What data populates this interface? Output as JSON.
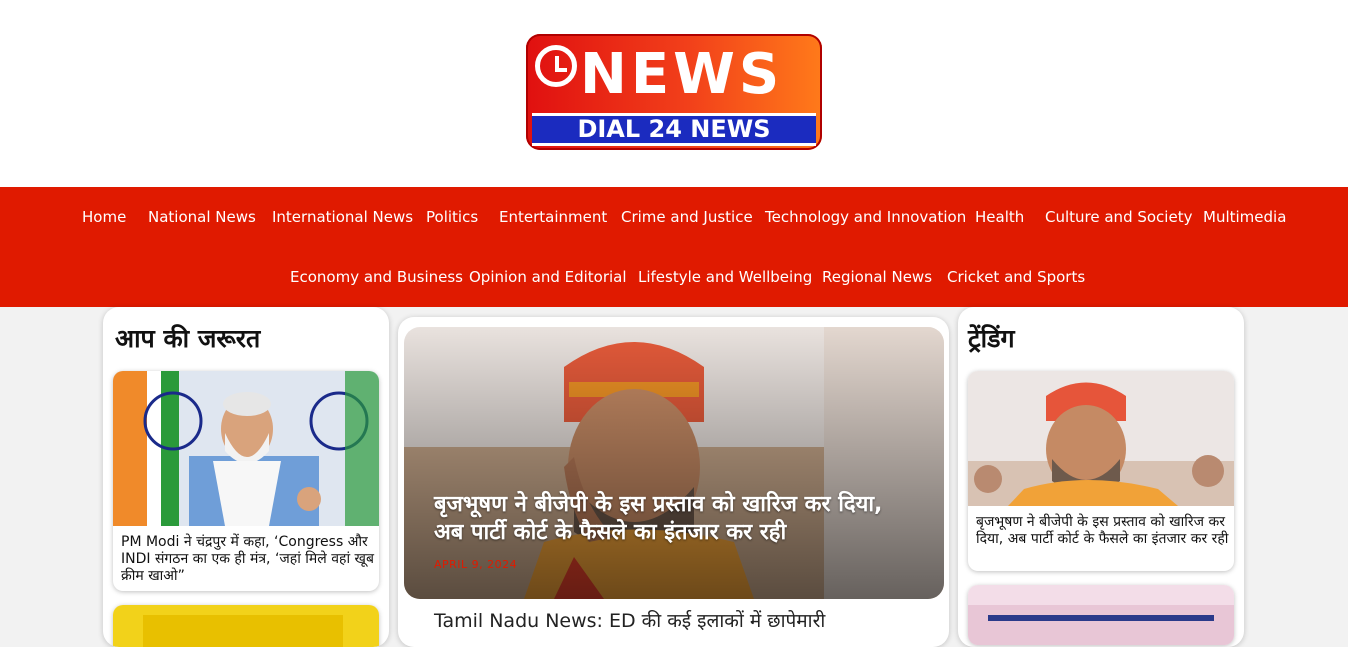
{
  "logo": {
    "main": "NEWS",
    "sub": "DIAL 24 NEWS"
  },
  "nav": {
    "row1": [
      "Home",
      "National News",
      "International News",
      "Politics",
      "Entertainment",
      "Crime and Justice",
      "Technology and Innovation",
      "Health",
      "Culture and Society",
      "Multimedia"
    ],
    "row2": [
      "Economy and Business",
      "Opinion and Editorial",
      "Lifestyle and Wellbeing",
      "Regional News",
      "Cricket and Sports"
    ]
  },
  "left": {
    "title": "आप की जरूरत",
    "card1": {
      "caption": "PM Modi ने चंद्रपुर में कहा, ‘Congress और INDI संगठन का एक ही मंत्र, ‘जहां मिले वहां खूब क्रीम खाओ”"
    }
  },
  "center": {
    "headline": "बृजभूषण ने बीजेपी के इस प्रस्ताव को खारिज कर दिया, अब पार्टी कोर्ट के फैसले का इंतजार कर रही",
    "date": "APRIL 9, 2024",
    "next_headline": "Tamil Nadu News: ED की कई इलाकों में छापेमारी"
  },
  "right": {
    "title": "ट्रेंडिंग",
    "card1": {
      "caption": "बृजभूषण ने बीजेपी के इस प्रस्ताव को खारिज कर दिया, अब पार्टी कोर्ट के फैसले का इंतजार कर रही"
    }
  },
  "colors": {
    "nav_bg": "#e01a00",
    "date": "#e01a00",
    "logo_blue": "#1b2bbf"
  }
}
